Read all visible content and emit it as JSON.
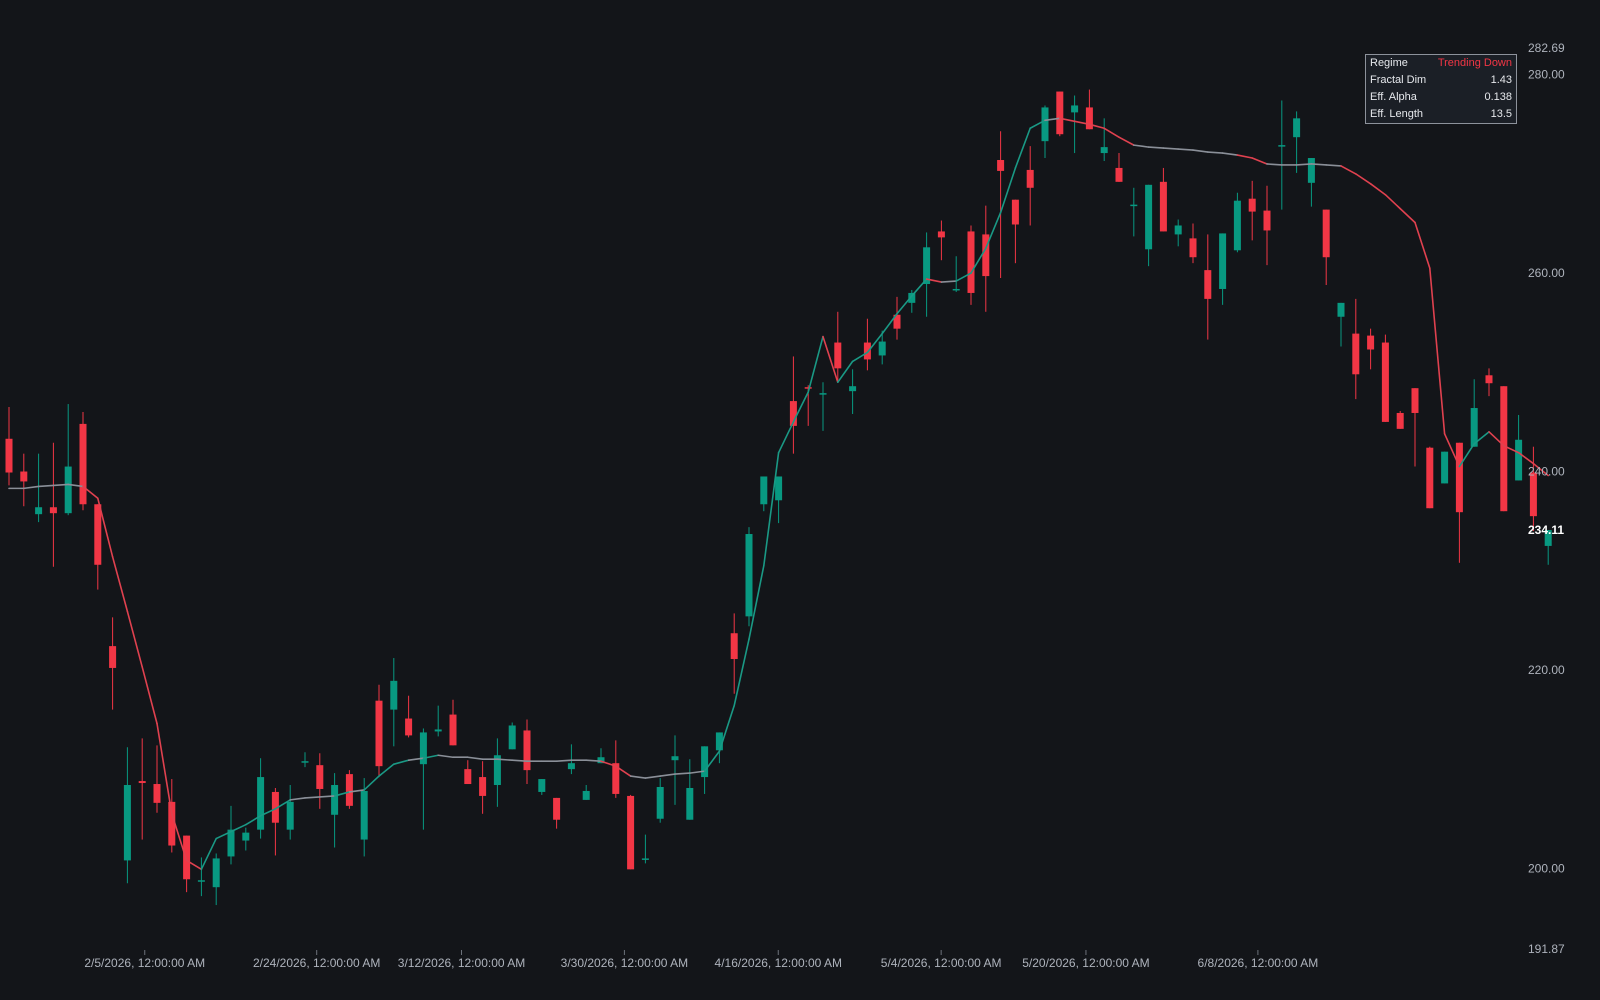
{
  "chart_data": {
    "type": "candlestick",
    "y_axis": {
      "ticks": [
        200,
        220,
        240,
        260,
        280
      ],
      "range": [
        191.87,
        282.69
      ],
      "range_labels": [
        "282.69",
        "191.87"
      ],
      "last_price": "234.11"
    },
    "x_axis": {
      "start": "2026-01-21",
      "ticks": [
        "2/5/2026, 12:00:00 AM",
        "2/24/2026, 12:00:00 AM",
        "3/12/2026, 12:00:00 AM",
        "3/30/2026, 12:00:00 AM",
        "4/16/2026, 12:00:00 AM",
        "5/4/2026, 12:00:00 AM",
        "5/20/2026, 12:00:00 AM",
        "6/8/2026, 12:00:00 AM"
      ]
    },
    "colors": {
      "up": "#089981",
      "down": "#f23645",
      "line_up": "#1a9985",
      "line_down": "#e0414f",
      "line_flat": "#8a8f98",
      "background": "#131519"
    },
    "series": [
      {
        "name": "OHLC",
        "candles": [
          [
            243.3,
            246.5,
            238.6,
            239.9
          ],
          [
            240.0,
            241.8,
            236.5,
            239.0
          ],
          [
            235.7,
            241.8,
            234.9,
            236.4
          ],
          [
            236.4,
            242.9,
            230.4,
            235.8
          ],
          [
            235.8,
            246.8,
            235.6,
            240.5
          ],
          [
            244.8,
            246.0,
            236.1,
            236.7
          ],
          [
            236.7,
            236.7,
            228.1,
            230.6
          ],
          [
            222.4,
            225.3,
            216.0,
            220.2
          ],
          [
            200.8,
            212.2,
            198.5,
            208.4
          ],
          [
            208.8,
            213.1,
            202.9,
            208.6
          ],
          [
            208.5,
            212.4,
            205.6,
            206.6
          ],
          [
            206.7,
            209.0,
            201.6,
            202.3
          ],
          [
            203.3,
            203.3,
            197.6,
            198.9
          ],
          [
            198.8,
            201.1,
            197.2,
            198.8
          ],
          [
            198.1,
            201.5,
            196.3,
            201.0
          ],
          [
            201.2,
            206.3,
            200.4,
            203.9
          ],
          [
            202.8,
            204.1,
            201.8,
            203.6
          ],
          [
            203.9,
            211.1,
            203.0,
            209.2
          ],
          [
            207.7,
            208.1,
            201.3,
            204.6
          ],
          [
            203.9,
            208.4,
            202.9,
            206.7
          ],
          [
            210.7,
            211.7,
            210.2,
            210.8
          ],
          [
            210.4,
            211.6,
            206.0,
            208.0
          ],
          [
            205.4,
            209.6,
            202.1,
            208.4
          ],
          [
            209.5,
            209.9,
            206.0,
            206.3
          ],
          [
            202.9,
            209.1,
            201.2,
            207.8
          ],
          [
            216.9,
            218.5,
            209.2,
            210.3
          ],
          [
            216.0,
            221.2,
            212.3,
            218.9
          ],
          [
            215.1,
            217.4,
            213.2,
            213.4
          ],
          [
            210.5,
            214.1,
            203.9,
            213.7
          ],
          [
            213.8,
            216.4,
            213.3,
            214.0
          ],
          [
            215.5,
            217.0,
            212.5,
            212.4
          ],
          [
            210.0,
            210.9,
            208.6,
            208.5
          ],
          [
            209.2,
            210.8,
            205.5,
            207.3
          ],
          [
            208.4,
            213.1,
            206.2,
            211.4
          ],
          [
            212.0,
            214.7,
            214.0,
            214.4
          ],
          [
            213.9,
            215.0,
            208.5,
            209.9
          ],
          [
            207.7,
            208.4,
            207.4,
            209.0
          ],
          [
            207.1,
            206.9,
            204.0,
            204.9
          ],
          [
            210.0,
            212.5,
            209.5,
            210.6
          ],
          [
            206.9,
            208.4,
            207.4,
            207.8
          ],
          [
            210.6,
            212.1,
            210.7,
            211.2
          ],
          [
            210.6,
            212.9,
            207.1,
            207.5
          ],
          [
            207.3,
            207.4,
            200.6,
            199.9
          ],
          [
            201.0,
            203.4,
            200.5,
            201.0
          ],
          [
            205.0,
            209.1,
            204.6,
            208.2
          ],
          [
            210.9,
            213.4,
            206.4,
            211.3
          ],
          [
            204.9,
            211.0,
            205.2,
            208.1
          ],
          [
            209.2,
            212.3,
            207.5,
            212.3
          ],
          [
            211.9,
            213.7,
            210.6,
            213.7
          ],
          [
            223.7,
            225.7,
            217.6,
            221.1
          ],
          [
            225.4,
            234.4,
            224.4,
            233.7
          ],
          [
            236.7,
            238.4,
            236.0,
            239.5
          ],
          [
            237.1,
            238.1,
            234.8,
            239.5
          ],
          [
            247.1,
            251.6,
            241.8,
            244.6
          ],
          [
            248.5,
            248.7,
            244.6,
            248.4
          ],
          [
            247.8,
            249.0,
            244.1,
            247.9
          ],
          [
            253.0,
            256.1,
            249.2,
            250.4
          ],
          [
            248.1,
            250.3,
            245.8,
            248.6
          ],
          [
            253.0,
            255.4,
            250.2,
            251.3
          ],
          [
            251.7,
            254.2,
            250.8,
            253.1
          ],
          [
            255.8,
            257.6,
            253.3,
            254.4
          ],
          [
            257.0,
            258.3,
            256.0,
            258.0
          ],
          [
            258.9,
            264.1,
            255.6,
            262.6
          ],
          [
            264.2,
            265.3,
            261.3,
            263.6
          ],
          [
            258.4,
            261.7,
            258.1,
            258.4
          ],
          [
            264.2,
            264.8,
            256.8,
            258.0
          ],
          [
            263.9,
            266.8,
            256.1,
            259.7
          ],
          [
            271.4,
            274.3,
            259.5,
            270.3
          ],
          [
            267.4,
            267.4,
            261.0,
            264.9
          ],
          [
            270.4,
            272.8,
            264.8,
            268.6
          ],
          [
            273.3,
            276.9,
            271.6,
            276.7
          ],
          [
            278.3,
            275.1,
            273.8,
            274.0
          ],
          [
            276.2,
            277.9,
            272.1,
            276.9
          ],
          [
            276.7,
            278.5,
            275.9,
            274.5
          ],
          [
            272.1,
            275.6,
            271.3,
            272.7
          ],
          [
            270.6,
            272.1,
            269.2,
            269.2
          ],
          [
            266.8,
            268.6,
            263.7,
            266.9
          ],
          [
            262.4,
            266.6,
            260.7,
            268.9
          ],
          [
            269.2,
            270.6,
            268.0,
            264.2
          ],
          [
            263.9,
            265.4,
            262.7,
            264.8
          ],
          [
            263.5,
            265.0,
            261.0,
            261.6
          ],
          [
            260.3,
            263.9,
            253.3,
            257.4
          ],
          [
            258.4,
            263.5,
            256.8,
            264.0
          ],
          [
            262.3,
            268.1,
            262.1,
            267.3
          ],
          [
            267.5,
            269.3,
            263.3,
            266.2
          ],
          [
            266.3,
            268.8,
            260.8,
            264.3
          ],
          [
            272.8,
            277.4,
            266.4,
            272.9
          ],
          [
            273.7,
            276.3,
            270.1,
            275.6
          ],
          [
            269.1,
            269.6,
            266.7,
            271.6
          ],
          [
            266.4,
            266.4,
            258.8,
            261.6
          ],
          [
            255.6,
            256.7,
            252.6,
            257.0
          ],
          [
            253.9,
            257.4,
            247.3,
            249.8
          ],
          [
            253.7,
            254.4,
            250.3,
            252.3
          ],
          [
            253.0,
            253.8,
            247.8,
            245.0
          ],
          [
            245.9,
            246.1,
            247.2,
            244.3
          ],
          [
            248.4,
            246.1,
            240.5,
            245.9
          ],
          [
            242.4,
            242.5,
            236.7,
            236.3
          ],
          [
            238.8,
            239.3,
            239.4,
            242.0
          ],
          [
            242.9,
            242.6,
            230.8,
            235.9
          ],
          [
            242.5,
            249.3,
            247.8,
            246.4
          ],
          [
            249.7,
            250.4,
            247.6,
            248.9
          ],
          [
            248.6,
            247.7,
            245.2,
            236.0
          ],
          [
            239.1,
            245.7,
            241.1,
            243.2
          ],
          [
            239.9,
            242.5,
            234.0,
            235.5
          ],
          [
            232.5,
            234.1,
            230.6,
            234.1
          ]
        ]
      },
      {
        "name": "Adaptive MA",
        "values": [
          238.3,
          238.3,
          238.5,
          238.6,
          238.7,
          238.5,
          237.3,
          231.4,
          225.9,
          220.3,
          214.6,
          205.5,
          200.8,
          199.9,
          203.0,
          203.7,
          204.4,
          205.3,
          206.0,
          206.9,
          207.1,
          207.2,
          207.3,
          207.7,
          207.9,
          209.3,
          210.5,
          210.9,
          211.1,
          211.4,
          211.2,
          211.2,
          211.0,
          211.0,
          210.9,
          210.8,
          210.8,
          210.8,
          210.9,
          210.9,
          210.8,
          210.3,
          209.3,
          209.1,
          209.3,
          209.5,
          209.6,
          209.8,
          211.8,
          216.4,
          223.1,
          230.5,
          241.9,
          245.0,
          248.0,
          253.6,
          249.0,
          251.1,
          252.0,
          253.9,
          255.9,
          257.7,
          259.4,
          259.1,
          259.2,
          260.0,
          262.5,
          266.1,
          270.6,
          274.6,
          275.4,
          275.6,
          275.3,
          275.0,
          274.6,
          273.7,
          272.9,
          272.7,
          272.6,
          272.5,
          272.4,
          272.2,
          272.1,
          271.9,
          271.6,
          271.0,
          270.9,
          270.9,
          271.0,
          270.9,
          270.8,
          270.0,
          269.0,
          267.9,
          266.5,
          265.1,
          260.5,
          243.8,
          240.5,
          242.8,
          244.0,
          242.6,
          241.9,
          240.8,
          239.6
        ]
      }
    ],
    "info_panel": {
      "rows": [
        {
          "label": "Regime",
          "value": "Trending Down"
        },
        {
          "label": "Fractal Dim",
          "value": "1.43"
        },
        {
          "label": "Eff. Alpha",
          "value": "0.138"
        },
        {
          "label": "Eff. Length",
          "value": "13.5"
        }
      ]
    }
  }
}
